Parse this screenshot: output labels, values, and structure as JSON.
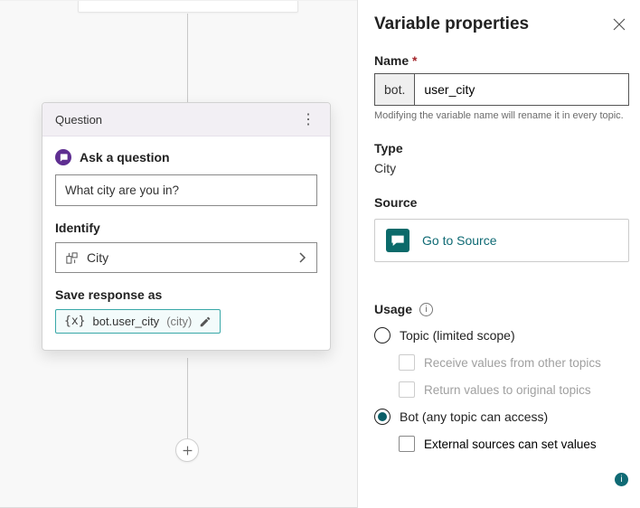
{
  "card": {
    "title": "Question",
    "ask_label": "Ask a question",
    "question_value": "What city are you in?",
    "identify_label": "Identify",
    "identify_value": "City",
    "save_label": "Save response as",
    "var_name": "bot.user_city",
    "var_type": "(city)"
  },
  "panel": {
    "title": "Variable properties",
    "name_label": "Name",
    "name_prefix": "bot.",
    "name_value": "user_city",
    "name_helper": "Modifying the variable name will rename it in every topic.",
    "type_label": "Type",
    "type_value": "City",
    "source_label": "Source",
    "source_button": "Go to Source",
    "usage_label": "Usage",
    "option_topic": "Topic (limited scope)",
    "check_receive": "Receive values from other topics",
    "check_return": "Return values to original topics",
    "option_bot": "Bot (any topic can access)",
    "check_external": "External sources can set values"
  }
}
